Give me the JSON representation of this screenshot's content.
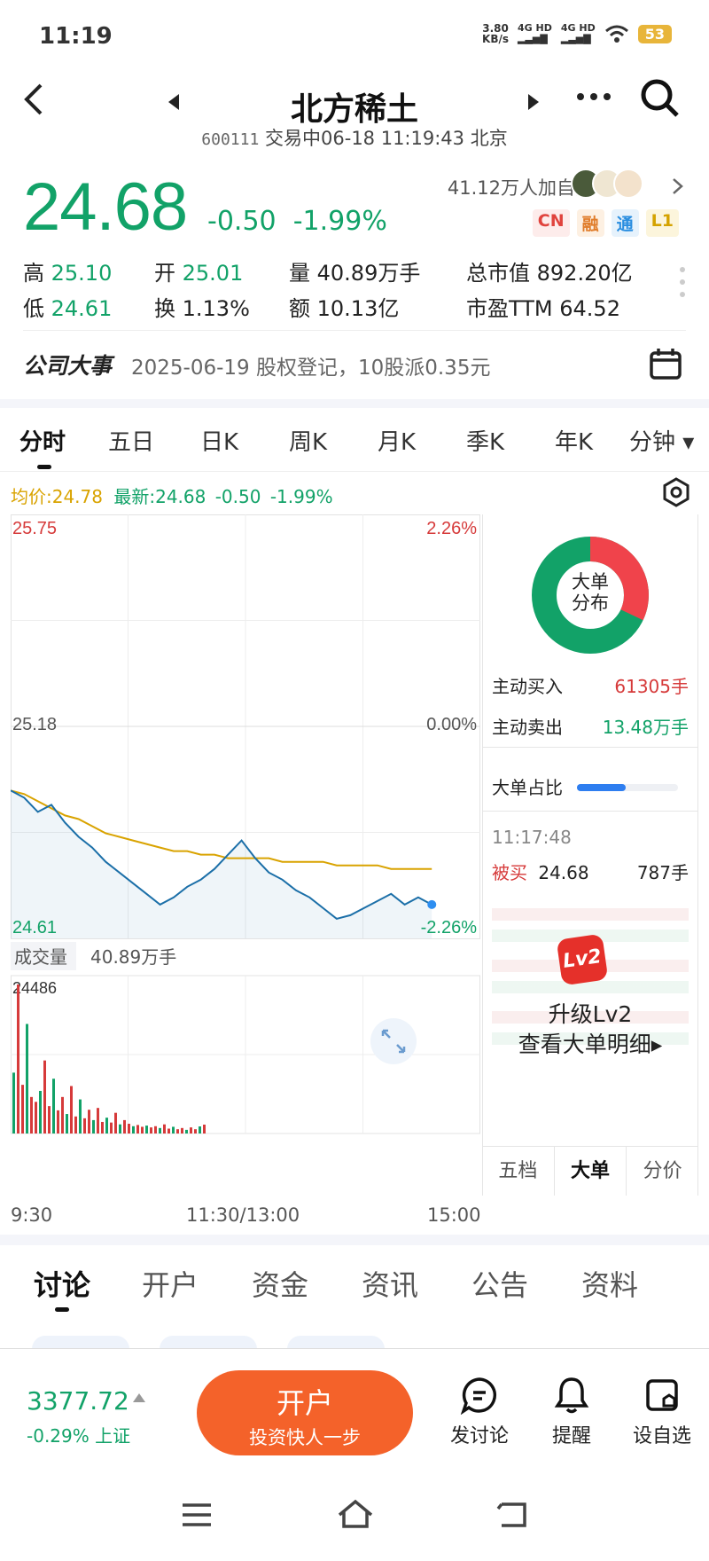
{
  "status_bar": {
    "time": "11:19",
    "speed_value": "3.80",
    "speed_unit": "KB/s",
    "net1": "4G HD",
    "net2": "4G HD",
    "battery": "53"
  },
  "header": {
    "title": "北方稀土",
    "code": "600111",
    "status": "交易中06-18 11:19:43 北京"
  },
  "quote": {
    "price": "24.68",
    "change": "-0.50",
    "change_pct": "-1.99%",
    "watchers": "41.12万人加自选",
    "badges": [
      "CN",
      "融",
      "通",
      "L1"
    ],
    "stats": {
      "high_label": "高",
      "high": "25.10",
      "open_label": "开",
      "open": "25.01",
      "vol_label": "量",
      "vol": "40.89万手",
      "cap_label": "总市值",
      "cap": "892.20亿",
      "low_label": "低",
      "low": "24.61",
      "turn_label": "换",
      "turn": "1.13%",
      "amt_label": "额",
      "amt": "10.13亿",
      "pe_label": "市盈TTM",
      "pe": "64.52"
    }
  },
  "event": {
    "label": "公司大事",
    "text": "2025-06-19 股权登记，10股派0.35元"
  },
  "chart_tabs": [
    "分时",
    "五日",
    "日K",
    "周K",
    "月K",
    "季K",
    "年K",
    "分钟 ▾"
  ],
  "chart_info": {
    "avg_label": "均价:24.78",
    "latest_label": "最新:24.68",
    "change": "-0.50",
    "change_pct": "-1.99%"
  },
  "chart_data": {
    "type": "line",
    "y_labels_left": [
      "25.75",
      "25.18",
      "24.61"
    ],
    "y_labels_right": [
      "2.26%",
      "0.00%",
      "-2.26%"
    ],
    "ylim": [
      24.61,
      25.75
    ],
    "x_labels": [
      "9:30",
      "11:30/13:00",
      "15:00"
    ],
    "price": [
      25.0,
      24.98,
      24.94,
      24.96,
      24.91,
      24.87,
      24.84,
      24.8,
      24.77,
      24.74,
      24.71,
      24.68,
      24.7,
      24.73,
      24.75,
      24.78,
      24.82,
      24.86,
      24.81,
      24.77,
      24.75,
      24.72,
      24.7,
      24.67,
      24.64,
      24.65,
      24.67,
      24.69,
      24.71,
      24.68,
      24.7,
      24.68
    ],
    "avg": [
      25.0,
      24.99,
      24.97,
      24.95,
      24.93,
      24.92,
      24.9,
      24.88,
      24.87,
      24.86,
      24.85,
      24.84,
      24.83,
      24.83,
      24.82,
      24.82,
      24.81,
      24.81,
      24.81,
      24.81,
      24.8,
      24.8,
      24.8,
      24.8,
      24.79,
      24.79,
      24.79,
      24.79,
      24.78,
      24.78,
      24.78,
      24.78
    ],
    "volume_label": "成交量",
    "volume_total": "40.89万手",
    "volume_max_label": "24486",
    "volume_max": 24486,
    "volume": [
      10000,
      24486,
      8000,
      18000,
      6000,
      5200,
      7000,
      12000,
      4500,
      9000,
      3800,
      6000,
      3200,
      7800,
      2800,
      5600,
      2500,
      3900,
      2200,
      4200,
      1900,
      2600,
      1800,
      3400,
      1500,
      2200,
      1600,
      1200,
      1400,
      1100,
      1300,
      1000,
      1200,
      900,
      1500,
      800,
      1100,
      700,
      900,
      600,
      1000,
      700
    ]
  },
  "side_panel": {
    "donut_label_1": "大单",
    "donut_label_2": "分布",
    "donut_buy_fraction": 0.32,
    "buy_label": "主动买入",
    "buy_value": "61305手",
    "sell_label": "主动卖出",
    "sell_value": "13.48万手",
    "ratio_label": "大单占比",
    "ratio_fraction": 0.48,
    "trade_time": "11:17:48",
    "trade_type": "被买",
    "trade_price": "24.68",
    "trade_qty": "787手",
    "lv2_badge": "Lv2",
    "upgrade_1": "升级Lv2",
    "upgrade_2": "查看大单明细▸",
    "tabs": [
      "五档",
      "大单",
      "分价"
    ]
  },
  "news_tabs": [
    "讨论",
    "开户",
    "资金",
    "资讯",
    "公告",
    "资料"
  ],
  "footer": {
    "index_value": "3377.72",
    "index_change": "-0.29% 上证",
    "open_title": "开户",
    "open_sub": "投资快人一步",
    "btn_discuss": "发讨论",
    "btn_alert": "提醒",
    "btn_watch": "设自选"
  },
  "colors": {
    "up": "#d63a3a",
    "down": "#12a268",
    "avg": "#d9a300",
    "accent": "#f4622a"
  }
}
